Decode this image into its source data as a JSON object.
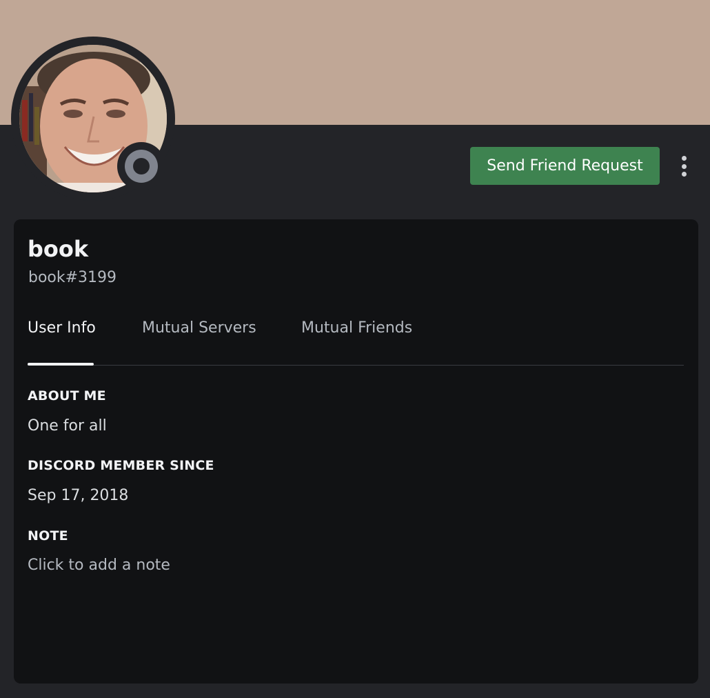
{
  "profile": {
    "banner_color": "#c0a796",
    "display_name": "book",
    "username": "book#3199",
    "status": "offline",
    "avatar_icon": "avatar-photo"
  },
  "actions": {
    "send_friend_request_label": "Send Friend Request",
    "send_friend_request_color": "#3e8350",
    "more_icon": "more-vertical-icon"
  },
  "tabs": [
    {
      "label": "User Info",
      "active": true
    },
    {
      "label": "Mutual Servers",
      "active": false
    },
    {
      "label": "Mutual Friends",
      "active": false
    }
  ],
  "user_info": {
    "about_me_heading": "ABOUT ME",
    "about_me_text": "One for all",
    "member_since_heading": "DISCORD MEMBER SINCE",
    "member_since_date": "Sep 17, 2018",
    "note_heading": "NOTE",
    "note_placeholder": "Click to add a note"
  }
}
